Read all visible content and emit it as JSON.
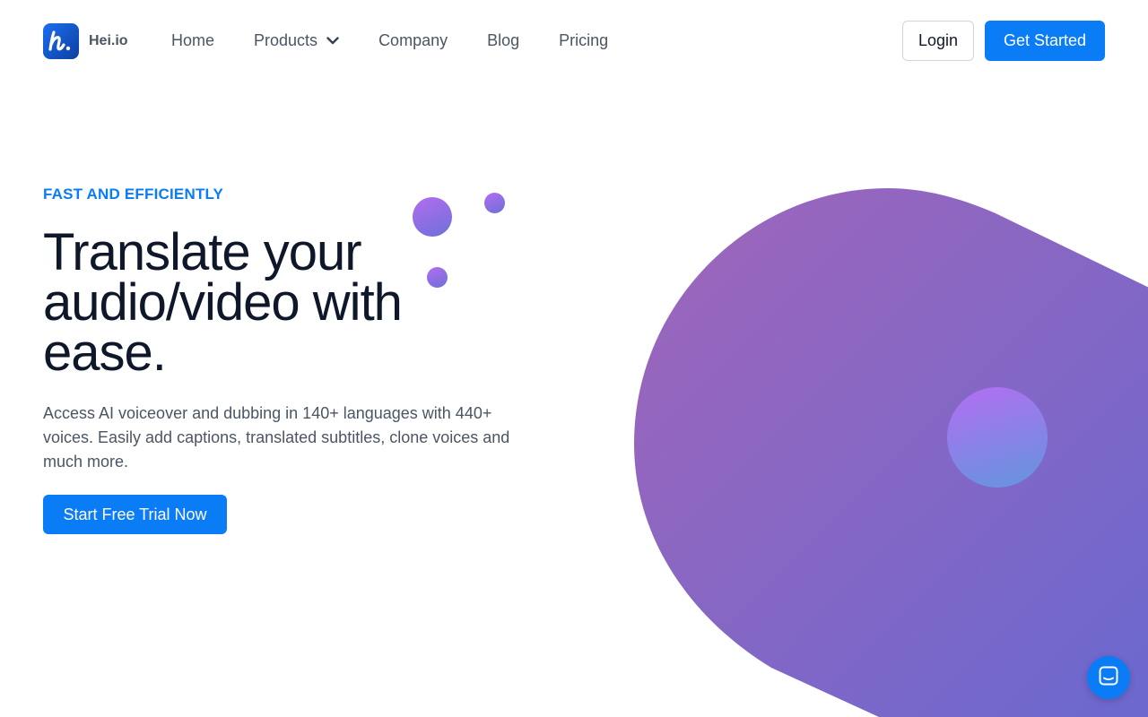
{
  "brand": {
    "name": "Hei.io",
    "logo_icon": "hei-logo-icon",
    "accent_color": "#0a7cf5"
  },
  "nav": {
    "items": [
      {
        "label": "Home"
      },
      {
        "label": "Products",
        "has_dropdown": true
      },
      {
        "label": "Company"
      },
      {
        "label": "Blog"
      },
      {
        "label": "Pricing"
      }
    ]
  },
  "header_actions": {
    "login_label": "Login",
    "get_started_label": "Get Started"
  },
  "hero": {
    "eyebrow": "FAST AND EFFICIENTLY",
    "headline": "Translate your audio/video with ease.",
    "description": "Access AI voiceover and dubbing in 140+ languages with 440+ voices. Easily add captions, translated subtitles, clone voices and much more.",
    "cta_label": "Start Free Trial Now"
  },
  "decor": {
    "blob_gradient": [
      "#a066ba",
      "#6a68cf"
    ],
    "orb_gradient": [
      "#b16ef0",
      "#6f8fe0"
    ]
  },
  "chat": {
    "icon": "chat-icon"
  }
}
